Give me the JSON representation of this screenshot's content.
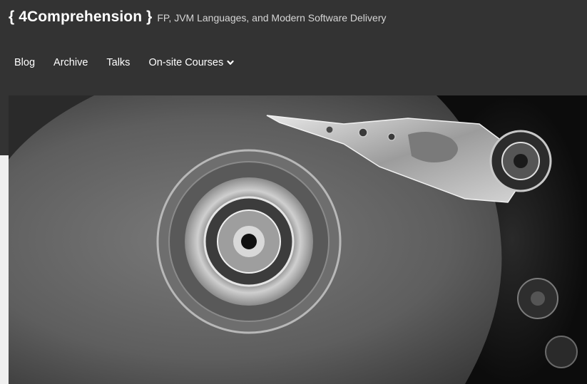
{
  "header": {
    "site_title": "{ 4Comprehension }",
    "tagline": "FP, JVM Languages, and Modern Software Delivery"
  },
  "nav": {
    "items": [
      {
        "label": "Blog"
      },
      {
        "label": "Archive"
      },
      {
        "label": "Talks"
      },
      {
        "label": "On-site Courses",
        "icon": "chevron-down-icon"
      }
    ]
  },
  "hero": {
    "image_subject": "hard-disk-drive-photo"
  },
  "colors": {
    "header_bg": "#333333",
    "page_bg": "#f1f1f1",
    "text": "#ffffff",
    "tagline": "#d6d6d6"
  }
}
